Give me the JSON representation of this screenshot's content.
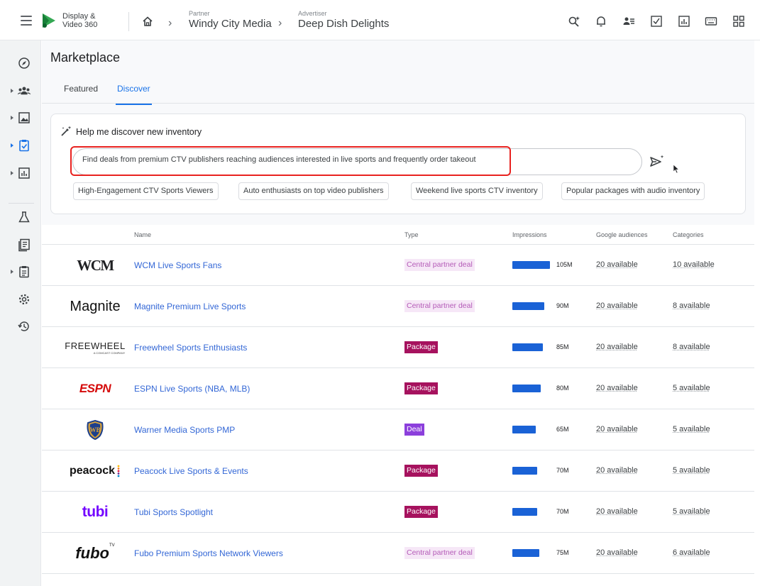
{
  "app": {
    "name_line1": "Display &",
    "name_line2": "Video 360"
  },
  "breadcrumb": [
    {
      "label": "Partner",
      "value": "Windy City Media"
    },
    {
      "label": "Advertiser",
      "value": "Deep Dish Delights"
    }
  ],
  "topbar_icons": [
    "search-sparkle-icon",
    "bell-icon",
    "people-list-icon",
    "checklist-icon",
    "report-icon",
    "keyboard-icon",
    "apps-grid-icon"
  ],
  "page": {
    "title": "Marketplace",
    "tabs": [
      {
        "label": "Featured",
        "active": false
      },
      {
        "label": "Discover",
        "active": true
      }
    ]
  },
  "discover": {
    "heading": "Help me discover new inventory",
    "query": "Find deals from premium CTV publishers reaching audiences interested in live sports and frequently order takeout",
    "chips": [
      "High-Engagement CTV Sports Viewers",
      "Auto enthusiasts on top video publishers",
      "Weekend live sports CTV inventory",
      "Popular packages with audio inventory"
    ]
  },
  "table": {
    "columns": [
      "Name",
      "Type",
      "Impressions",
      "Google audiences",
      "Categories"
    ],
    "rows": [
      {
        "logo": "WCM",
        "name": "WCM Live Sports Fans",
        "type": "Central partner deal",
        "impressions": "105M",
        "impressions_value": 105,
        "audiences": "20 available",
        "categories": "10 available"
      },
      {
        "logo": "Magnite",
        "name": "Magnite Premium Live Sports",
        "type": "Central partner deal",
        "impressions": "90M",
        "impressions_value": 90,
        "audiences": "20 available",
        "categories": "8 available"
      },
      {
        "logo": "FREEWHEEL",
        "logo_sub": "A COMCAST COMPANY",
        "name": "Freewheel Sports Enthusiasts",
        "type": "Package",
        "impressions": "85M",
        "impressions_value": 85,
        "audiences": "20 available",
        "categories": "8 available"
      },
      {
        "logo": "ESPN",
        "name": "ESPN Live Sports (NBA, MLB)",
        "type": "Package",
        "impressions": "80M",
        "impressions_value": 80,
        "audiences": "20 available",
        "categories": "5 available"
      },
      {
        "logo": "WB",
        "name": "Warner Media Sports PMP",
        "type": "Deal",
        "impressions": "65M",
        "impressions_value": 65,
        "audiences": "20 available",
        "categories": "5 available"
      },
      {
        "logo": "peacock",
        "name": "Peacock Live Sports & Events",
        "type": "Package",
        "impressions": "70M",
        "impressions_value": 70,
        "audiences": "20 available",
        "categories": "5 available"
      },
      {
        "logo": "tubi",
        "name": "Tubi Sports Spotlight",
        "type": "Package",
        "impressions": "70M",
        "impressions_value": 70,
        "audiences": "20 available",
        "categories": "5 available"
      },
      {
        "logo": "fubo",
        "logo_sup": "TV",
        "name": "Fubo Premium Sports Network Viewers",
        "type": "Central partner deal",
        "impressions": "75M",
        "impressions_value": 75,
        "audiences": "20 available",
        "categories": "6 available"
      }
    ]
  },
  "colors": {
    "accent": "#1a73e8",
    "bar": "#1a62d6",
    "highlight": "#e8221f",
    "package": "#a6125e",
    "deal": "#8c3fdc",
    "central": "#f6e7f7"
  }
}
